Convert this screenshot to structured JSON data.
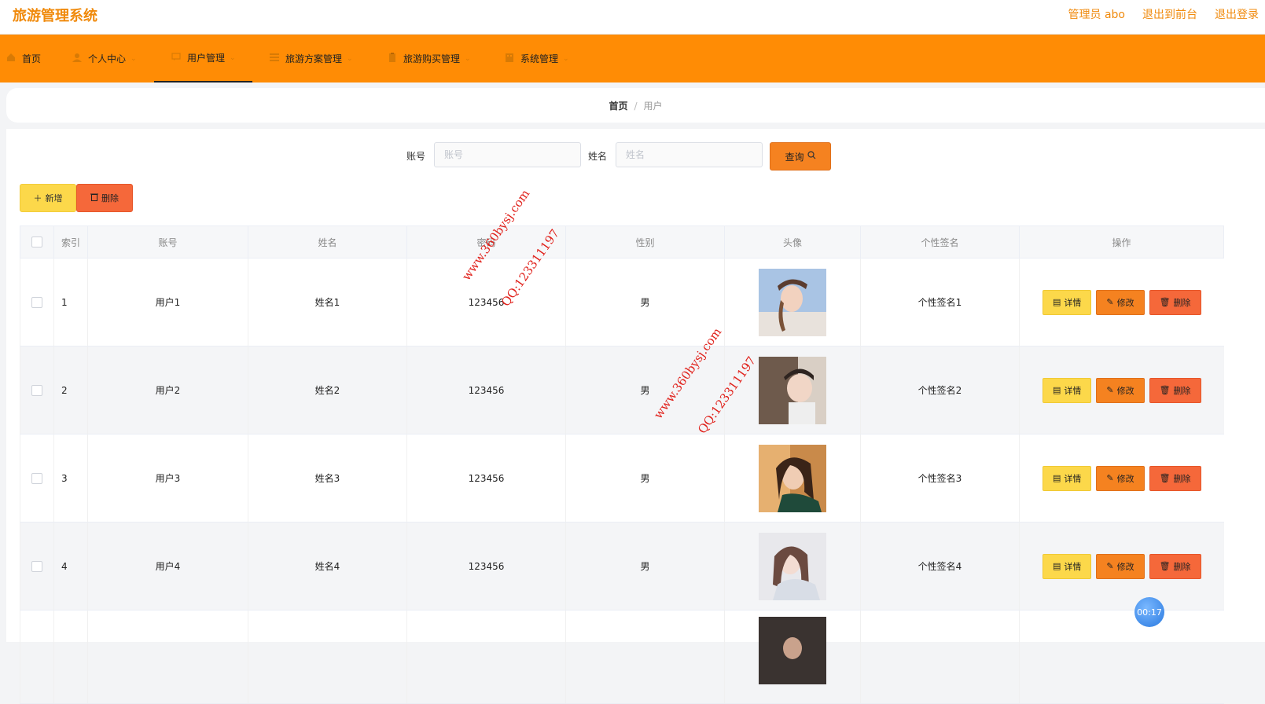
{
  "header": {
    "app_title": "旅游管理系统",
    "admin_label": "管理员 abo",
    "to_frontend": "退出到前台",
    "logout": "退出登录"
  },
  "nav": [
    {
      "label": "首页",
      "icon": "home-icon"
    },
    {
      "label": "个人中心",
      "icon": "user-icon"
    },
    {
      "label": "用户管理",
      "icon": "chat-icon"
    },
    {
      "label": "旅游方案管理",
      "icon": "list-icon"
    },
    {
      "label": "旅游购买管理",
      "icon": "clipboard-icon"
    },
    {
      "label": "系统管理",
      "icon": "building-icon"
    }
  ],
  "breadcrumb": {
    "home": "首页",
    "separator": "/",
    "current": "用户"
  },
  "search": {
    "account_label": "账号",
    "account_placeholder": "账号",
    "account_value": "",
    "name_label": "姓名",
    "name_placeholder": "姓名",
    "name_value": "",
    "query_label": "查询"
  },
  "actions": {
    "add_label": "新增",
    "delete_label": "删除"
  },
  "table": {
    "headers": [
      "索引",
      "账号",
      "姓名",
      "密码",
      "性别",
      "头像",
      "个性签名",
      "操作"
    ],
    "rows": [
      {
        "index": "1",
        "account": "用户1",
        "name": "姓名1",
        "password": "123456",
        "gender": "男",
        "signature": "个性签名1"
      },
      {
        "index": "2",
        "account": "用户2",
        "name": "姓名2",
        "password": "123456",
        "gender": "男",
        "signature": "个性签名2"
      },
      {
        "index": "3",
        "account": "用户3",
        "name": "姓名3",
        "password": "123456",
        "gender": "男",
        "signature": "个性签名3"
      },
      {
        "index": "4",
        "account": "用户4",
        "name": "姓名4",
        "password": "123456",
        "gender": "男",
        "signature": "个性签名4"
      }
    ],
    "row_actions": {
      "detail": "详情",
      "edit": "修改",
      "delete": "删除"
    }
  },
  "watermark": {
    "site": "www.360bysj.com",
    "qq": "QQ:123311197"
  },
  "timer": "00:17",
  "colors": {
    "accent": "#ff8c05",
    "title": "#f08a0c",
    "yellow": "#fcd84a",
    "red": "#f5683a"
  }
}
